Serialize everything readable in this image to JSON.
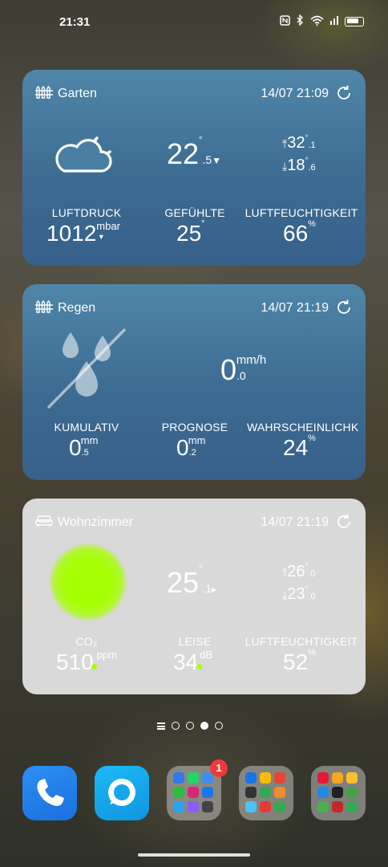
{
  "status_bar": {
    "time": "21:31",
    "icons": [
      "nfc-icon",
      "bluetooth-icon",
      "wifi-icon",
      "signal-icon",
      "battery-icon"
    ]
  },
  "widgets": {
    "garten": {
      "title": "Garten",
      "time": "14/07 21:09",
      "condition_icon": "partly-cloudy-night-icon",
      "temperature": {
        "int": "22",
        "deg": "°",
        "dec": ".5",
        "trend": "▼"
      },
      "high": {
        "int": "32",
        "deg": "°",
        "dec": ".1"
      },
      "low": {
        "int": "18",
        "deg": "°",
        "dec": ".6"
      },
      "pressure": {
        "label": "LUFTDRUCK",
        "value": "1012",
        "unit": "mbar",
        "trend": "▼"
      },
      "feels_like": {
        "label": "GEFÜHLTE",
        "value": "25",
        "deg": "°"
      },
      "humidity": {
        "label": "LUFTFEUCHTIGKEIT",
        "value": "66",
        "unit": "%"
      }
    },
    "regen": {
      "title": "Regen",
      "time": "14/07 21:19",
      "condition_icon": "no-rain-icon",
      "rate": {
        "int": "0",
        "dec": ".0",
        "unit": "mm/h"
      },
      "cumulative": {
        "label": "KUMULATIV",
        "int": "0",
        "dec": ".5",
        "unit": "mm"
      },
      "forecast": {
        "label": "PROGNOSE",
        "int": "0",
        "dec": ".2",
        "unit": "mm"
      },
      "probability": {
        "label": "WAHRSCHEINLICHK",
        "value": "24",
        "unit": "%"
      }
    },
    "wohnzimmer": {
      "title": "Wohnzimmer",
      "time": "14/07 21:19",
      "status_color": "#a6ff00",
      "temperature": {
        "int": "25",
        "deg": "°",
        "dec": ".1",
        "trend": "▸"
      },
      "high": {
        "int": "26",
        "deg": "°",
        "dec": ".0"
      },
      "low": {
        "int": "23",
        "deg": "°",
        "dec": ".0"
      },
      "co2": {
        "label": "CO₂",
        "value": "510",
        "unit": "ppm"
      },
      "noise": {
        "label": "LEISE",
        "value": "34",
        "unit": "dB"
      },
      "humidity": {
        "label": "LUFTFEUCHTIGKEIT",
        "value": "52",
        "unit": "%"
      }
    }
  },
  "pager": {
    "page_count": 4,
    "active_index": 2
  },
  "dock": {
    "folder_badge": "1",
    "colors": {
      "phone": "#2b8ff6",
      "messages": "#1db9f5",
      "badge": "#f03a3a"
    }
  }
}
